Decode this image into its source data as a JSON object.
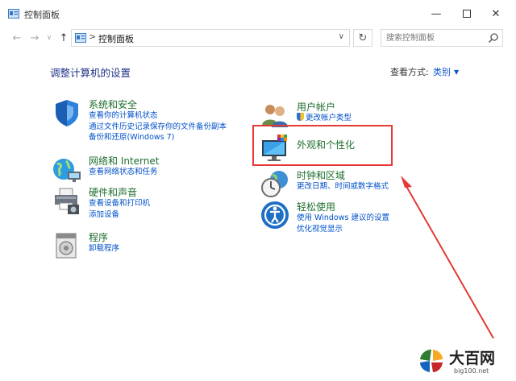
{
  "window": {
    "title": "控制面板"
  },
  "address": {
    "crumb": "控制面板",
    "separator": ">"
  },
  "search": {
    "placeholder": "搜索控制面板"
  },
  "main": {
    "heading": "调整计算机的设置",
    "view_by_label": "查看方式:",
    "view_by_value": "类别"
  },
  "categories": [
    {
      "title": "系统和安全",
      "links": [
        "查看你的计算机状态",
        "通过文件历史记录保存你的文件备份副本",
        "备份和还原(Windows 7)"
      ]
    },
    {
      "title": "网络和 Internet",
      "links": [
        "查看网络状态和任务"
      ]
    },
    {
      "title": "硬件和声音",
      "links": [
        "查看设备和打印机",
        "添加设备"
      ]
    },
    {
      "title": "程序",
      "links": [
        "卸载程序"
      ]
    },
    {
      "title": "用户帐户",
      "links": [
        "更改帐户类型"
      ]
    },
    {
      "title": "外观和个性化",
      "links": []
    },
    {
      "title": "时钟和区域",
      "links": [
        "更改日期、时间或数字格式"
      ]
    },
    {
      "title": "轻松使用",
      "links": [
        "使用 Windows 建议的设置",
        "优化视觉显示"
      ]
    }
  ],
  "watermark": {
    "brand": "大百网",
    "url": "big100.net"
  },
  "colors": {
    "category_title": "#1e6e2e",
    "link": "#0050c8",
    "highlight": "#e53935",
    "heading": "#1e3287"
  }
}
